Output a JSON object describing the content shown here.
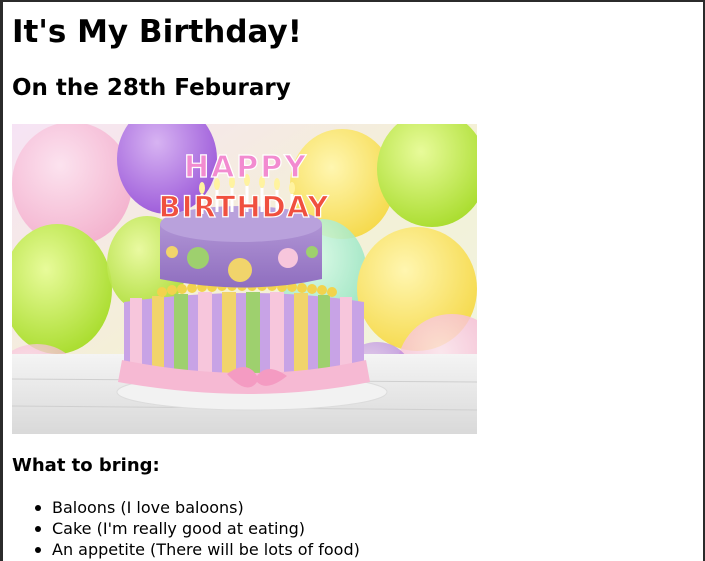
{
  "page": {
    "title": "It's My Birthday!",
    "subtitle": "On the 28th Feburary"
  },
  "image": {
    "banner_line_1": "HAPPY",
    "banner_line_2": "BIRTHDAY"
  },
  "bring": {
    "heading": "What to bring:",
    "items": [
      "Baloons (I love baloons)",
      "Cake (I'm really good at eating)",
      "An appetite (There will be lots of food)"
    ]
  }
}
